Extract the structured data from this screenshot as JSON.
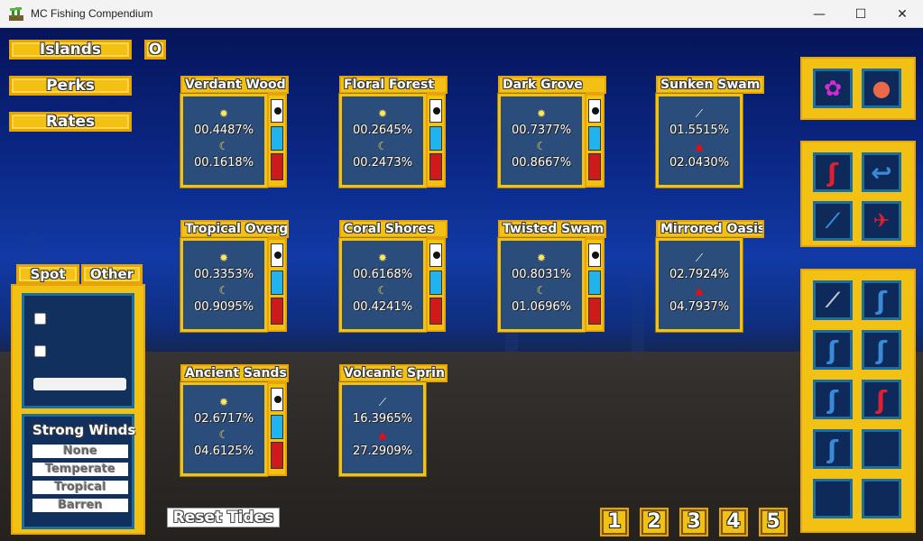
{
  "window": {
    "title": "MC Fishing Compendium",
    "minimize": "—",
    "maximize": "☐",
    "close": "✕"
  },
  "nav": {
    "islands": "Islands",
    "o": "O",
    "perks": "Perks",
    "rates": "Rates"
  },
  "cards": [
    {
      "name": "Verdant Wood",
      "type": "tide",
      "top": "00.4487%",
      "bottom": "00.1618%"
    },
    {
      "name": "Floral Forest",
      "type": "tide",
      "top": "00.2645%",
      "bottom": "00.2473%"
    },
    {
      "name": "Dark Grove",
      "type": "tide",
      "top": "00.7377%",
      "bottom": "00.8667%"
    },
    {
      "name": "Sunken Swam",
      "type": "rod",
      "top": "01.5515%",
      "bottom": "02.0430%"
    },
    {
      "name": "Tropical Overg",
      "type": "tide",
      "top": "00.3353%",
      "bottom": "00.9095%"
    },
    {
      "name": "Coral Shores",
      "type": "tide",
      "top": "00.6168%",
      "bottom": "00.4241%"
    },
    {
      "name": "Twisted Swam",
      "type": "tide",
      "top": "00.8031%",
      "bottom": "01.0696%"
    },
    {
      "name": "Mirrored Oasis",
      "type": "rod",
      "top": "02.7924%",
      "bottom": "04.7937%"
    },
    {
      "name": "Ancient Sands",
      "type": "tide",
      "top": "02.6717%",
      "bottom": "04.6125%"
    },
    {
      "name": "Volcanic Sprin",
      "type": "rod",
      "top": "16.3965%",
      "bottom": "27.2909%"
    }
  ],
  "left_panel": {
    "tab_spot": "Spot",
    "tab_other": "Other",
    "weather_title": "Strong Winds",
    "options": [
      "None",
      "Temperate",
      "Tropical",
      "Barren"
    ],
    "selected": "None"
  },
  "reset_button": "Reset Tides",
  "pages": [
    "1",
    "2",
    "3",
    "4",
    "5"
  ]
}
